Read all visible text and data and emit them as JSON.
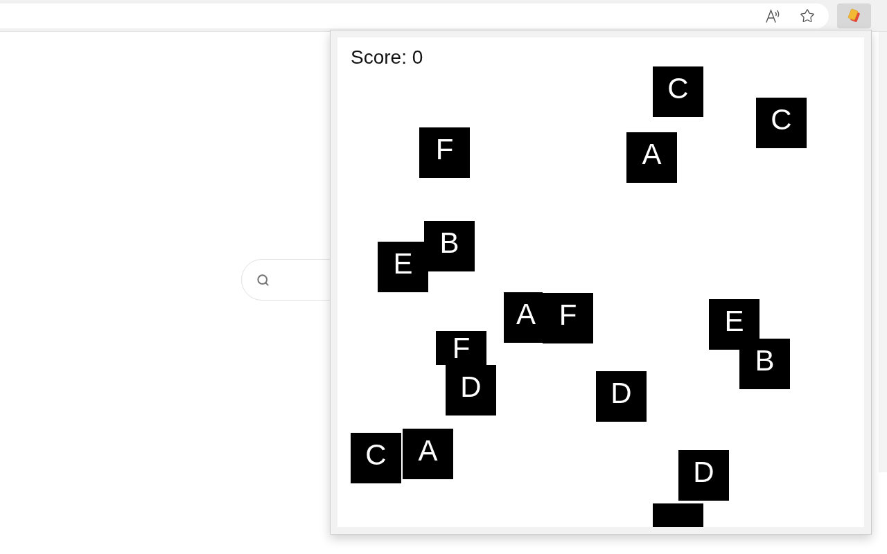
{
  "popup": {
    "score": "Score: 0",
    "tiles": [
      {
        "kind": "tile",
        "letter": "C"
      },
      {
        "kind": "tile",
        "letter": "C"
      },
      {
        "kind": "tile",
        "letter": "F"
      },
      {
        "kind": "tile",
        "letter": "A"
      },
      {
        "kind": "tile",
        "letter": "B"
      },
      {
        "kind": "tile",
        "letter": "E"
      },
      {
        "kind": "tile",
        "letter": "A"
      },
      {
        "kind": "tile",
        "letter": "F"
      },
      {
        "kind": "tile",
        "letter": "E"
      },
      {
        "kind": "tile",
        "letter": "F"
      },
      {
        "kind": "tile",
        "letter": "B"
      },
      {
        "kind": "tile",
        "letter": "D"
      },
      {
        "kind": "tile",
        "letter": "D"
      },
      {
        "kind": "tile",
        "letter": "A"
      },
      {
        "kind": "tile",
        "letter": "C"
      },
      {
        "kind": "tile",
        "letter": "D"
      },
      {
        "kind": "cut-tile"
      }
    ]
  }
}
